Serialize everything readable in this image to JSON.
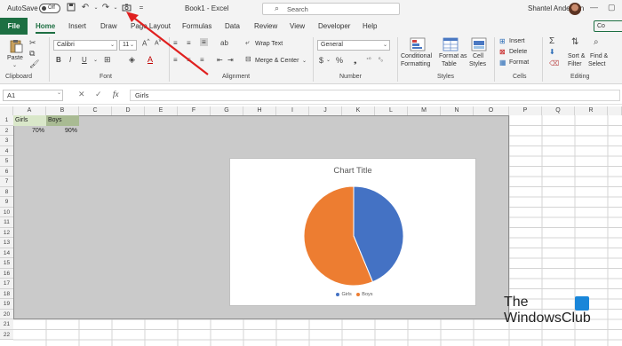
{
  "titlebar": {
    "autosave_label": "AutoSave",
    "autosave_state": "Off",
    "doc_title": "Book1 - Excel",
    "search_placeholder": "Search",
    "user_name": "Shantel Anderson",
    "customize_label": "="
  },
  "tabs": {
    "file": "File",
    "items": [
      "Home",
      "Insert",
      "Draw",
      "Page Layout",
      "Formulas",
      "Data",
      "Review",
      "View",
      "Developer",
      "Help"
    ],
    "share_label": "Co"
  },
  "ribbon": {
    "clipboard": {
      "paste": "Paste",
      "label": "Clipboard"
    },
    "font": {
      "name": "Calibri",
      "size": "11",
      "label": "Font"
    },
    "alignment": {
      "wrap": "Wrap Text",
      "merge": "Merge & Center",
      "label": "Alignment"
    },
    "number": {
      "format": "General",
      "label": "Number"
    },
    "styles": {
      "conditional_1": "Conditional",
      "conditional_2": "Formatting",
      "format_table_1": "Format as",
      "format_table_2": "Table",
      "cell_styles_1": "Cell",
      "cell_styles_2": "Styles",
      "label": "Styles"
    },
    "cells": {
      "insert": "Insert",
      "delete": "Delete",
      "format": "Format",
      "label": "Cells"
    },
    "editing": {
      "sort_1": "Sort &",
      "sort_2": "Filter",
      "find_1": "Find &",
      "find_2": "Select",
      "label": "Editing"
    }
  },
  "formula_bar": {
    "name_box": "A1",
    "fx": "fx",
    "content": "Girls"
  },
  "grid": {
    "columns": [
      "A",
      "B",
      "C",
      "D",
      "E",
      "F",
      "G",
      "H",
      "I",
      "J",
      "K",
      "L",
      "M",
      "N",
      "O",
      "P",
      "Q",
      "R"
    ],
    "rows": [
      "1",
      "2",
      "3",
      "4",
      "5",
      "6",
      "7",
      "8",
      "9",
      "10",
      "11",
      "12",
      "13",
      "14",
      "15",
      "16",
      "17",
      "18",
      "19",
      "20",
      "21",
      "22"
    ],
    "cells": {
      "a1": "Girls",
      "b1": "Boys",
      "a2": "70%",
      "b2": "90%"
    }
  },
  "chart_data": {
    "type": "pie",
    "title": "Chart Title",
    "categories": [
      "Girls",
      "Boys"
    ],
    "values": [
      70,
      90
    ],
    "colors": [
      "#4472c4",
      "#ed7d31"
    ],
    "legend_position": "bottom"
  },
  "watermark": {
    "line1": "The",
    "line2": "WindowsClub"
  }
}
